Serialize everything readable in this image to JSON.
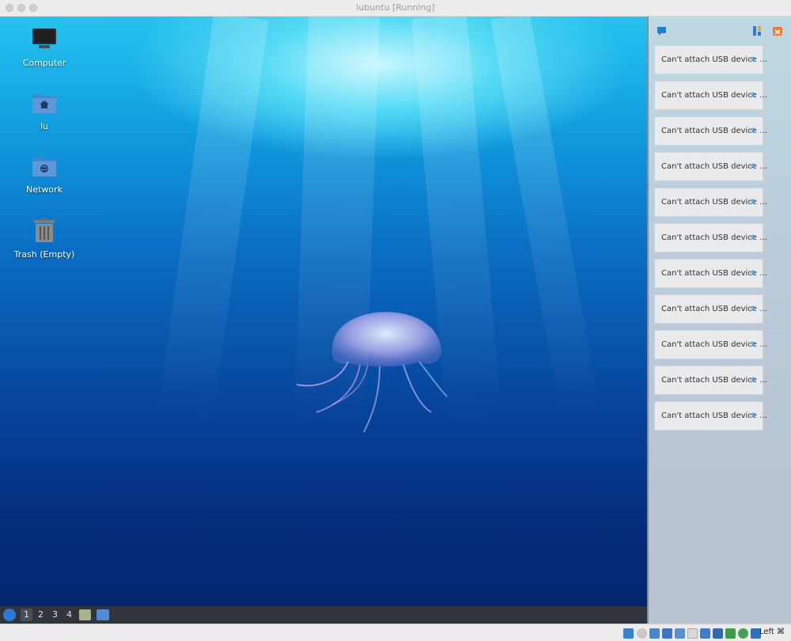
{
  "window": {
    "title": "lubuntu [Running]"
  },
  "desktop": {
    "icons": [
      {
        "label": "Computer"
      },
      {
        "label": "lu"
      },
      {
        "label": "Network"
      },
      {
        "label": "Trash (Empty)"
      }
    ]
  },
  "panel": {
    "workspaces": [
      "1",
      "2",
      "3",
      "4"
    ],
    "active_workspace": "1"
  },
  "notifications": {
    "items": [
      {
        "text": "Can't attach USB device ..."
      },
      {
        "text": "Can't attach USB device ..."
      },
      {
        "text": "Can't attach USB device ..."
      },
      {
        "text": "Can't attach USB device ..."
      },
      {
        "text": "Can't attach USB device ..."
      },
      {
        "text": "Can't attach USB device ..."
      },
      {
        "text": "Can't attach USB device ..."
      },
      {
        "text": "Can't attach USB device ..."
      },
      {
        "text": "Can't attach USB device ..."
      },
      {
        "text": "Can't attach USB device ..."
      },
      {
        "text": "Can't attach USB device ..."
      }
    ]
  },
  "statusbar": {
    "host_key": "Left ⌘",
    "icons": [
      "hard-disk-icon",
      "optical-disk-icon",
      "audio-icon",
      "network-icon",
      "usb-icon",
      "shared-folders-icon",
      "display-icon",
      "video-capture-icon",
      "cpu-icon",
      "mouse-integration-icon",
      "keyboard-icon"
    ]
  }
}
